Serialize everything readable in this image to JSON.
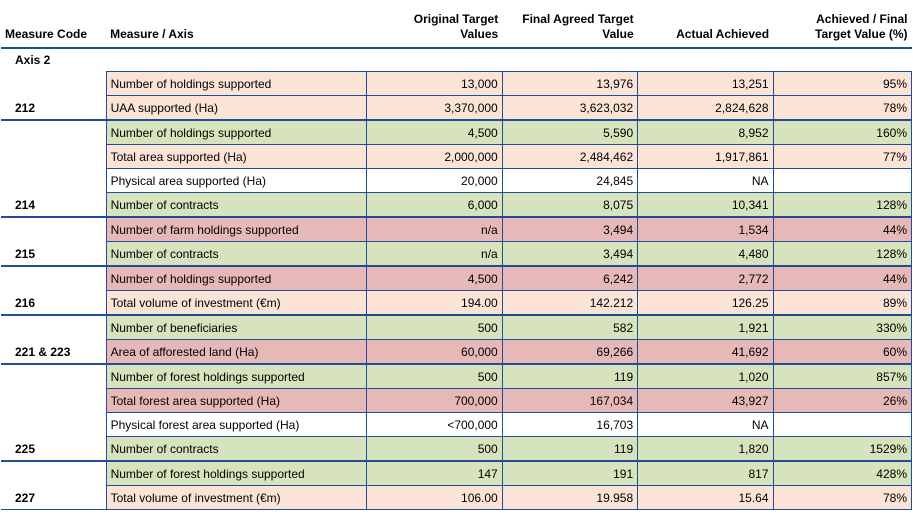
{
  "headers": {
    "code": "Measure Code",
    "measure": "Measure / Axis",
    "original_l1": "Original Target",
    "original_l2": "Values",
    "final_l1": "Final Agreed Target",
    "final_l2": "Value",
    "actual": "Actual Achieved",
    "pct_l1": "Achieved / Final",
    "pct_l2": "Target Value (%)"
  },
  "axis_label": "Axis 2",
  "rows": [
    {
      "code": "",
      "measure": "Number of holdings supported",
      "original": "13,000",
      "final": "13,976",
      "actual": "13,251",
      "pct": "95%",
      "color": "peach"
    },
    {
      "code": "212",
      "measure": "UAA supported (Ha)",
      "original": "3,370,000",
      "final": "3,623,032",
      "actual": "2,824,628",
      "pct": "78%",
      "color": "peach"
    },
    {
      "code": "",
      "measure": "Number of holdings supported",
      "original": "4,500",
      "final": "5,590",
      "actual": "8,952",
      "pct": "160%",
      "color": "green"
    },
    {
      "code": "",
      "measure": "Total area supported (Ha)",
      "original": "2,000,000",
      "final": "2,484,462",
      "actual": "1,917,861",
      "pct": "77%",
      "color": "peach"
    },
    {
      "code": "",
      "measure": "Physical area supported (Ha)",
      "original": "20,000",
      "final": "24,845",
      "actual": "NA",
      "pct": "",
      "color": "white"
    },
    {
      "code": "214",
      "measure": "Number of contracts",
      "original": "6,000",
      "final": "8,075",
      "actual": "10,341",
      "pct": "128%",
      "color": "green"
    },
    {
      "code": "",
      "measure": "Number of farm holdings supported",
      "original": "n/a",
      "final": "3,494",
      "actual": "1,534",
      "pct": "44%",
      "color": "red"
    },
    {
      "code": "215",
      "measure": "Number of contracts",
      "original": "n/a",
      "final": "3,494",
      "actual": "4,480",
      "pct": "128%",
      "color": "green"
    },
    {
      "code": "",
      "measure": "Number of holdings supported",
      "original": "4,500",
      "final": "6,242",
      "actual": "2,772",
      "pct": "44%",
      "color": "red"
    },
    {
      "code": "216",
      "measure": "Total volume of investment (€m)",
      "original": "194.00",
      "final": "142.212",
      "actual": "126.25",
      "pct": "89%",
      "color": "peach"
    },
    {
      "code": "",
      "measure": "Number of beneficiaries",
      "original": "500",
      "final": "582",
      "actual": "1,921",
      "pct": "330%",
      "color": "green"
    },
    {
      "code": "221 & 223",
      "measure": "Area of afforested land (Ha)",
      "original": "60,000",
      "final": "69,266",
      "actual": "41,692",
      "pct": "60%",
      "color": "red"
    },
    {
      "code": "",
      "measure": "Number of forest holdings supported",
      "original": "500",
      "final": "119",
      "actual": "1,020",
      "pct": "857%",
      "color": "green"
    },
    {
      "code": "",
      "measure": "Total forest area supported (Ha)",
      "original": "700,000",
      "final": "167,034",
      "actual": "43,927",
      "pct": "26%",
      "color": "red"
    },
    {
      "code": "",
      "measure": "Physical forest area supported (Ha)",
      "original": "<700,000",
      "final": "16,703",
      "actual": "NA",
      "pct": "",
      "color": "white"
    },
    {
      "code": "225",
      "measure": "Number of contracts",
      "original": "500",
      "final": "119",
      "actual": "1,820",
      "pct": "1529%",
      "color": "green"
    },
    {
      "code": "",
      "measure": "Number of forest holdings supported",
      "original": "147",
      "final": "191",
      "actual": "817",
      "pct": "428%",
      "color": "green"
    },
    {
      "code": "227",
      "measure": "Total volume of investment (€m)",
      "original": "106.00",
      "final": "19.958",
      "actual": "15.64",
      "pct": "78%",
      "color": "peach"
    }
  ]
}
